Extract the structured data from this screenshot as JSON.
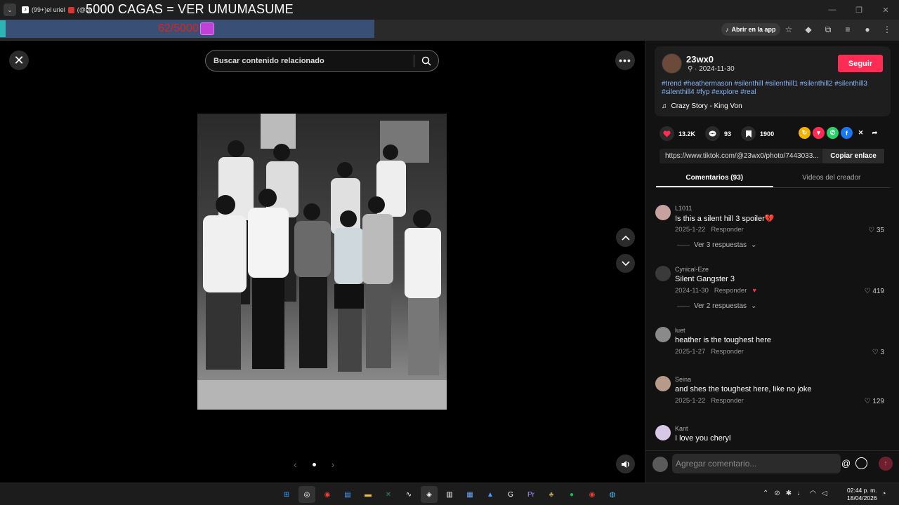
{
  "browser": {
    "tab_title": "(99+)el uriel",
    "tab_handle": "(@el",
    "overlay_title": "5000 CAGAS = VER UMUMASUME",
    "counter": "62/5000",
    "open_app_label": "Abrir en la app"
  },
  "viewer": {
    "search_placeholder": "Buscar contenido relacionado"
  },
  "post": {
    "username": "23wx0",
    "date": "· 2024-11-30",
    "follow_label": "Seguir",
    "hashtags": "#trend #heathermason #silenthill #silenthill1 #silenthill2 #silenthill3 #silenthill4 #fyp #explore #real",
    "music": "Crazy Story - King Von",
    "likes": "13.2K",
    "comments_count": "93",
    "saves": "1900",
    "link": "https://www.tiktok.com/@23wx0/photo/7443033...",
    "copy_label": "Copiar enlace"
  },
  "tabs": {
    "comments": "Comentarios (93)",
    "creator_videos": "Videos del creador"
  },
  "comments": [
    {
      "user": "L1011",
      "text": "Is this a silent hill 3 spoiler💔",
      "date": "2025-1-22",
      "reply": "Responder",
      "likes": "35",
      "replies": "Ver 3 respuestas",
      "avatar_color": "#c7a0a0"
    },
    {
      "user": "Cynical-Eze",
      "text": "Silent Gangster 3",
      "date": "2024-11-30",
      "reply": "Responder",
      "likes": "419",
      "replies": "Ver 2 respuestas",
      "avatar_color": "#3a3a3a"
    },
    {
      "user": "luet",
      "text": "heather is the toughest here",
      "date": "2025-1-27",
      "reply": "Responder",
      "likes": "3",
      "replies": "",
      "avatar_color": "#8a8a8a"
    },
    {
      "user": "Seina",
      "text": "and shes the toughest here, like no joke",
      "date": "2025-1-22",
      "reply": "Responder",
      "likes": "129",
      "replies": "",
      "avatar_color": "#b89a8a"
    },
    {
      "user": "Kant",
      "text": "I love you cheryl",
      "date": "",
      "reply": "",
      "likes": "",
      "replies": "",
      "avatar_color": "#d8c8e8"
    }
  ],
  "comment_input": {
    "placeholder": "Agregar comentario..."
  },
  "taskbar": {
    "time": "02:44 p. m.",
    "date": "18/04/2026"
  },
  "colors": {
    "accent": "#fe2c55",
    "hashtag": "#8ab4f8"
  }
}
